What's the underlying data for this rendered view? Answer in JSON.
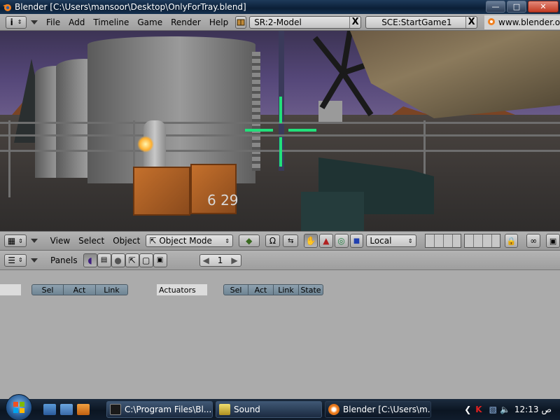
{
  "window": {
    "title": "Blender [C:\\Users\\mansoor\\Desktop\\OnlyForTray.blend]"
  },
  "info_header": {
    "menus": [
      "File",
      "Add",
      "Timeline",
      "Game",
      "Render",
      "Help"
    ],
    "screen_field": "SR:2-Model",
    "scene_field": "SCE:StartGame1",
    "url": "www.blender.org",
    "close_symbol": "X"
  },
  "viewport": {
    "hud_value": "6  29"
  },
  "view3d_header": {
    "menus": [
      "View",
      "Select",
      "Object"
    ],
    "mode": "Object Mode",
    "orientation": "Local"
  },
  "buttons_window": {
    "panels_label": "Panels",
    "frame_value": "1",
    "sensors_tabs": [
      "Sel",
      "Act",
      "Link"
    ],
    "actuators_label": "Actuators",
    "actuators_tabs": [
      "Sel",
      "Act",
      "Link",
      "State"
    ]
  },
  "taskbar": {
    "tasks": [
      {
        "label": "C:\\Program Files\\Bl..."
      },
      {
        "label": "Sound"
      },
      {
        "label": "Blender [C:\\Users\\m..."
      }
    ],
    "clock": "12:13",
    "ampm": "ص"
  },
  "colors": {
    "crosshair": "#21e07a",
    "tab_blue": "#7d92a1"
  }
}
